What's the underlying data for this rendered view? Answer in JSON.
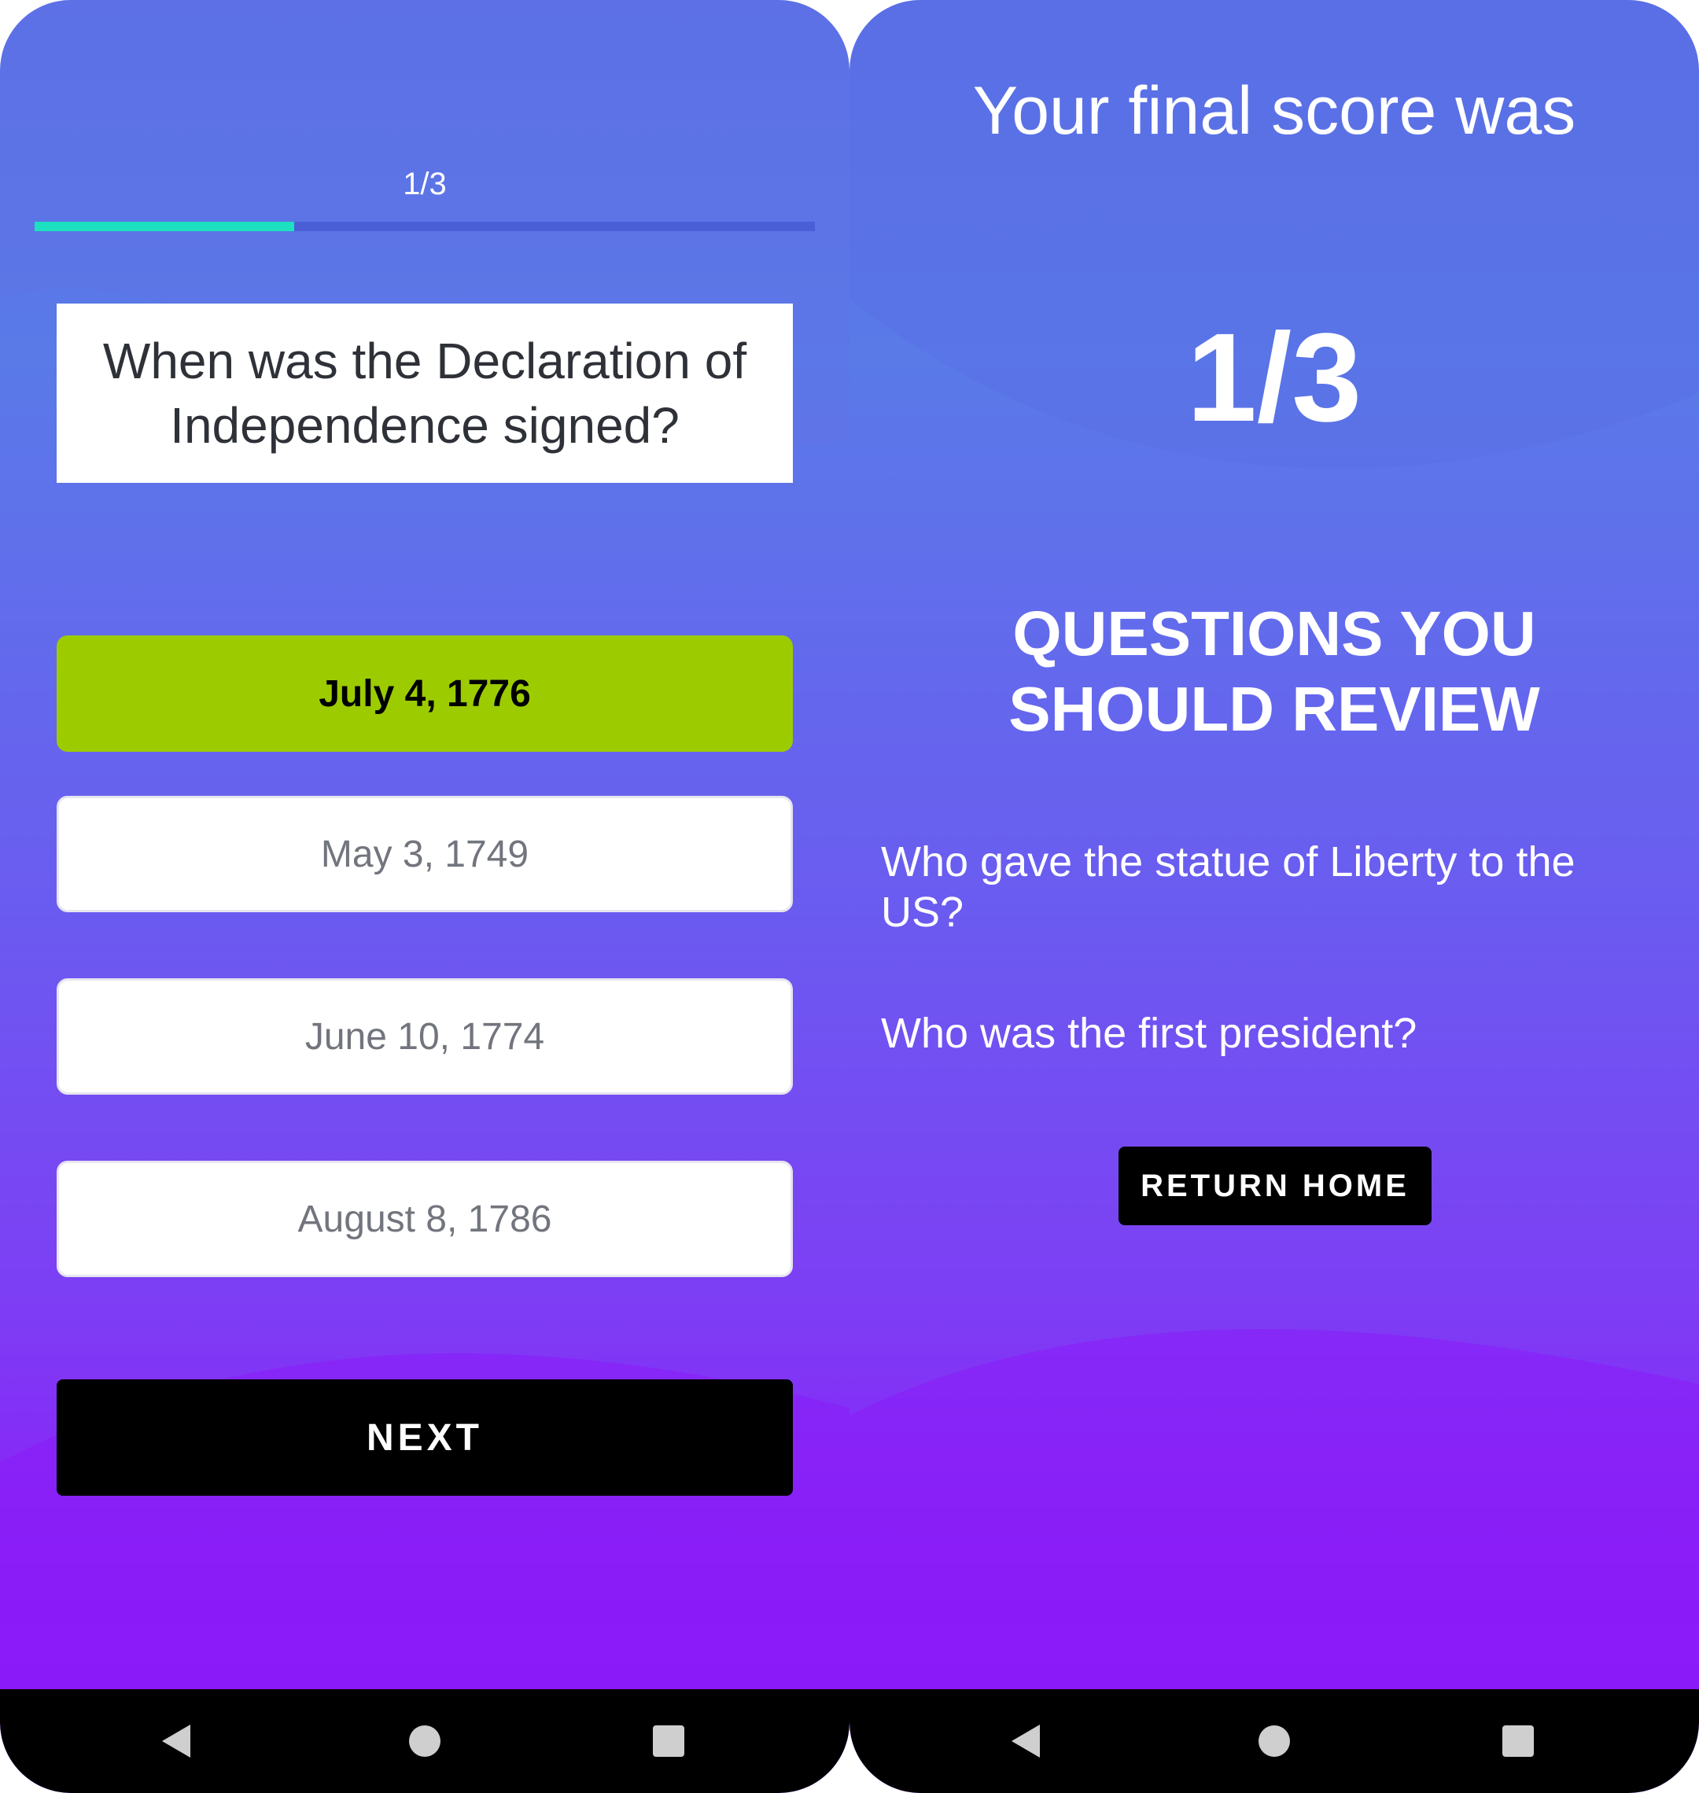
{
  "colors": {
    "gradient_top": "#5b6fe6",
    "gradient_bottom": "#8e17fb",
    "progress_fill": "#1de0c0",
    "selected_answer": "#9ccc00",
    "button_bg": "#000000"
  },
  "quiz_screen": {
    "progress": {
      "label": "1/3",
      "fraction": 0.333
    },
    "question": "When was the Declaration of Independence signed?",
    "answers": [
      {
        "label": "July 4, 1776",
        "selected": true
      },
      {
        "label": "May 3, 1749",
        "selected": false
      },
      {
        "label": "June 10, 1774",
        "selected": false
      },
      {
        "label": "August 8, 1786",
        "selected": false
      }
    ],
    "next_label": "NEXT"
  },
  "results_screen": {
    "heading": "Your final score was",
    "score": "1/3",
    "review_heading_line1": "QUESTIONS YOU",
    "review_heading_line2": "SHOULD REVIEW",
    "review_questions": [
      "Who gave the statue of Liberty to the US?",
      "Who was the first president?"
    ],
    "return_label": "RETURN HOME"
  },
  "nav_icons": [
    "back-icon",
    "home-icon",
    "recent-apps-icon"
  ]
}
